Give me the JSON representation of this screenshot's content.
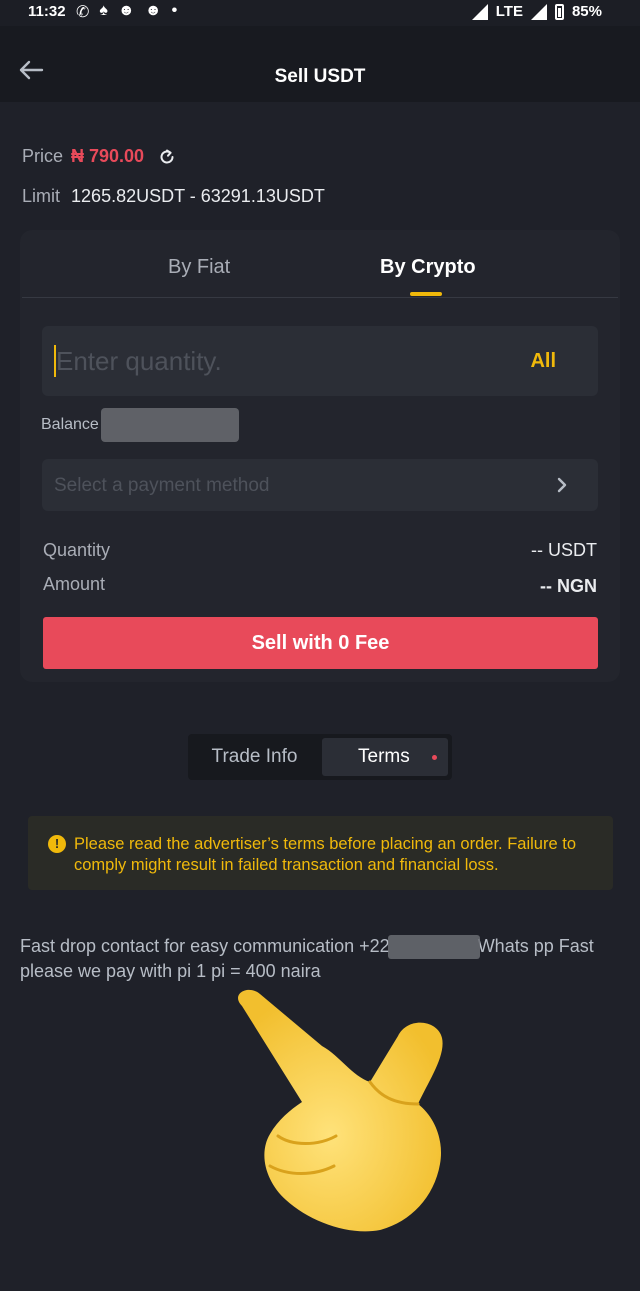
{
  "status_bar": {
    "time": "11:32",
    "notification_icons": [
      "whatsapp-icon",
      "snapchat-icon",
      "discord-icon",
      "discord-icon",
      "dot-icon"
    ],
    "network": "LTE",
    "battery": "85%"
  },
  "header": {
    "title": "Sell USDT",
    "back_icon": "arrow-left-icon"
  },
  "price": {
    "label": "Price",
    "value": "₦ 790.00",
    "refresh_icon": "refresh-icon"
  },
  "limit": {
    "label": "Limit",
    "value": "1265.82USDT - 63291.13USDT"
  },
  "tabs": {
    "items": [
      {
        "label": "By Fiat",
        "active": false
      },
      {
        "label": "By Crypto",
        "active": true
      }
    ]
  },
  "quantity_input": {
    "placeholder": "Enter quantity.",
    "value": "",
    "all_label": "All"
  },
  "balance": {
    "label": "Balance"
  },
  "payment": {
    "placeholder": "Select a payment method"
  },
  "summary": {
    "quantity_label": "Quantity",
    "quantity_value": "-- USDT",
    "amount_label": "Amount",
    "amount_value": "-- NGN"
  },
  "sell_button": {
    "label": "Sell with 0 Fee"
  },
  "segment": {
    "items": [
      {
        "label": "Trade Info",
        "active": false
      },
      {
        "label": "Terms",
        "active": true
      }
    ]
  },
  "warning": {
    "text": "Please read the advertiser’s terms before placing an order. Failure to comply might result in failed transaction and financial loss."
  },
  "terms": {
    "text_before": "Fast  drop contact for easy communication +22",
    "text_after": "Whats pp Fast please we pay with pi  1 pi = 400 naira"
  },
  "colors": {
    "accent": "#f0b90b",
    "sell": "#e84a5a",
    "background": "#1f2129"
  }
}
